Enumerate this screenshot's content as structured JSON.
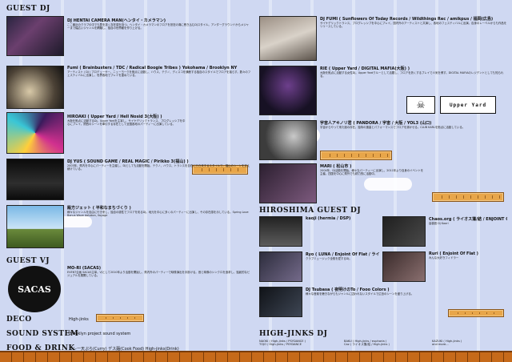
{
  "left": {
    "guest_dj_heading": "GUEST DJ",
    "guest_vj_heading": "GUEST VJ",
    "deco_heading": "DECO",
    "sound_heading": "SOUND SYSTEM",
    "food_heading": "FOOD & DRINK",
    "deco_value": "High-jinks",
    "sound_value": "Brooklyn project sound system",
    "food_value": "カレー天ぷら(Curry) デス麺(Cook Food) High-jinks(Drink)",
    "djs": [
      {
        "name": "DJ HENTAI CAMERA MAN(ヘンタイ・カメラマン)",
        "body": "ここ最近のクラブの中でも群を抜く存在感を持つ。ヘンタイ・カメラマンのフロアを熱狂の渦に巻き込むDJスタイル。アンダーグラウンドからメジャーまで幅広いジャンルを網羅し、独自の世界観を作り上げる。"
      },
      {
        "name": "Fumi ( Brainbusters / TDC / Radical Boogie Tribes ) Yokohama / Brooklyn NY",
        "body": "アーティスト / DJ / プロデューサー。ニューヨークを拠点に活動し、ハウス、テクノ、ディスコを横断する独自のスタイルでフロアを揺らす。数々のフェスティバルに出演し、世界各地でプレイを重ねている。"
      },
      {
        "name": "HIROAKI ( Upper Yard / Hell Nosid 3(大阪) )",
        "body": "大阪を拠点に活動するDJ。Upper Yardを主宰し、サイケデリックトランス、プログレッシブを中心にプレイ。関西のシーンを牽引する存在として全国各地のパーティーに出演している。"
      },
      {
        "name": "DJ YUS ( SOUND GAME / REAL MAGIC / Pirikko 3(福山) )",
        "body": "2003年、県内を中心にパーティーを主催し、DJとしても活動を開始。テクノ、ハウス、トランスを自在に行き来するスタイルで、福山のシーンを支え続けている。"
      },
      {
        "name": "殿方ジェット ( 平和なまちづくり )",
        "body": "様々なジャンルを自由に行き来し、独自の感性でフロアを彩るDJ。地元を中心に多くのパーティーに出演し、その存在感を示している。Spring Love Bonus Wave Aotokon, Voyage"
      }
    ],
    "vj": {
      "name": "MO-RI (SACAS)",
      "body": "EVENT企画 SACAS主宰。VJとして2010年より活動を開始し、県内外のパーティーで映像演出を手掛ける。音と映像のシンクロを追求し、独創的なビジュアルを展開している。"
    },
    "sacas_logo": "SACAS"
  },
  "right": {
    "hiroshima_heading": "HIROSHIMA GUEST DJ",
    "highjinks_heading": "HIGH-JINKS DJ",
    "djs": [
      {
        "name": "DJ FUMI ( Sunflowers Of Today Records / Wildthings Rec / amikpus / 福岡(広島)",
        "body": "サイケデリックトランス、プログレッシブを中心にプレイ。国内外のアーティストと共演し、各地のフェスティバルに出演。自身のレーベルからも作品をリリースしている。"
      },
      {
        "name": "RIE ( Upper Yard / DIGITAL MAFIA(大阪) )",
        "body": "大阪を拠点に活動する女性DJ。Upper Yardクルーとして活躍し、フロアを熱くするプレイで人気を博す。DIGITAL MAFIAのレジデントとしても知られる。"
      },
      {
        "name": "宇宙人アキノリ君 ( PANDORA / 宇宙 / 大阪 / YOL3 (山口)",
        "body": "宇宙からやって来た謎の存在。独特の選曲とパフォーマンスでフロアを沸かせる。CLUB KARLを拠点に活動している。"
      },
      {
        "name": "MARI ( 松山市 )",
        "body": "2004年、DJ活動を開始。様々なパーティーに出演し、2011年より自身のイベントを主催。四国を中心に県外でも精力的に活動中。"
      }
    ],
    "hiroshima_djs": [
      {
        "name": "kaoji (hermia / DSP)",
        "body": ""
      },
      {
        "name": "Chaos.org ( ライオス藩/結 / ENJOINT OF FLAT / HEAVY METAL SOUNDVOX / 不良少年 / 広島 LAND )",
        "body": "高橋悠 Dj Kaori"
      },
      {
        "name": "Ryo ( LUNA / Enjoint Of Flat / ライオス藩/結 )",
        "body": "クラブミュージック全般を愛するDJ。"
      },
      {
        "name": "Ruri ( Enjoint Of Flat )",
        "body": "みんな大好きフィドラー"
      },
      {
        "name": "DJ Tsubasa ( 夜明けのTo / Fooo Colors )",
        "body": "様々な音楽を聴きながらもジャンルに囚われないスタイルで広島のシーンを盛り上げる。"
      }
    ],
    "highjinks": [
      {
        "name": "NAOKI ( High-jinks / PSYDANCE )",
        "body": "TOJO / High-jinks / PSYDANCE"
      },
      {
        "name": "BAKU ( High-jinks / euphoria )",
        "body": "Caz ( ライオス藩/結 / High-jinks )"
      },
      {
        "name": "KAZUKI ( High-jinks )",
        "body": "and more..."
      }
    ],
    "upper_yard_logo": "Upper Yard",
    "skull_glyph": "☠"
  }
}
